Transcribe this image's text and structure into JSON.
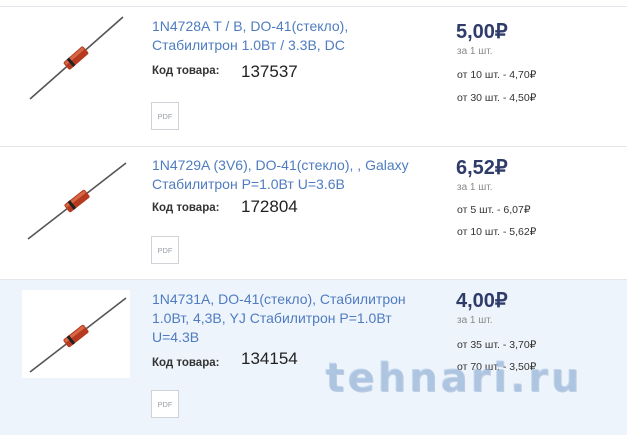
{
  "code_label": "Код товара:",
  "pdf_label": "PDF",
  "watermark": "tehnari.ru",
  "products": [
    {
      "title": "1N4728A T / B, DO-41(стекло), Стабилитрон 1.0Вт / 3.3В, DC",
      "code": "137537",
      "price": "5,00₽",
      "per_unit": "за 1 шт.",
      "tiers": [
        "от 10 шт. - 4,70₽",
        "от 30 шт. - 4,50₽"
      ]
    },
    {
      "title": "1N4729A (3V6), DO-41(стекло), , Galaxy Стабилитрон P=1.0Вт U=3.6В",
      "code": "172804",
      "price": "6,52₽",
      "per_unit": "за 1 шт.",
      "tiers": [
        "от 5 шт. - 6,07₽",
        "от 10 шт. - 5,62₽"
      ]
    },
    {
      "title": "1N4731A, DO-41(стекло), Стабилитрон 1.0Вт, 4,3В, YJ Стабилитрон P=1.0Вт U=4.3В",
      "code": "134154",
      "price": "4,00₽",
      "per_unit": "за 1 шт.",
      "tiers": [
        "от 35 шт. - 3,70₽",
        "от 70 шт. - 3,50₽"
      ]
    }
  ]
}
